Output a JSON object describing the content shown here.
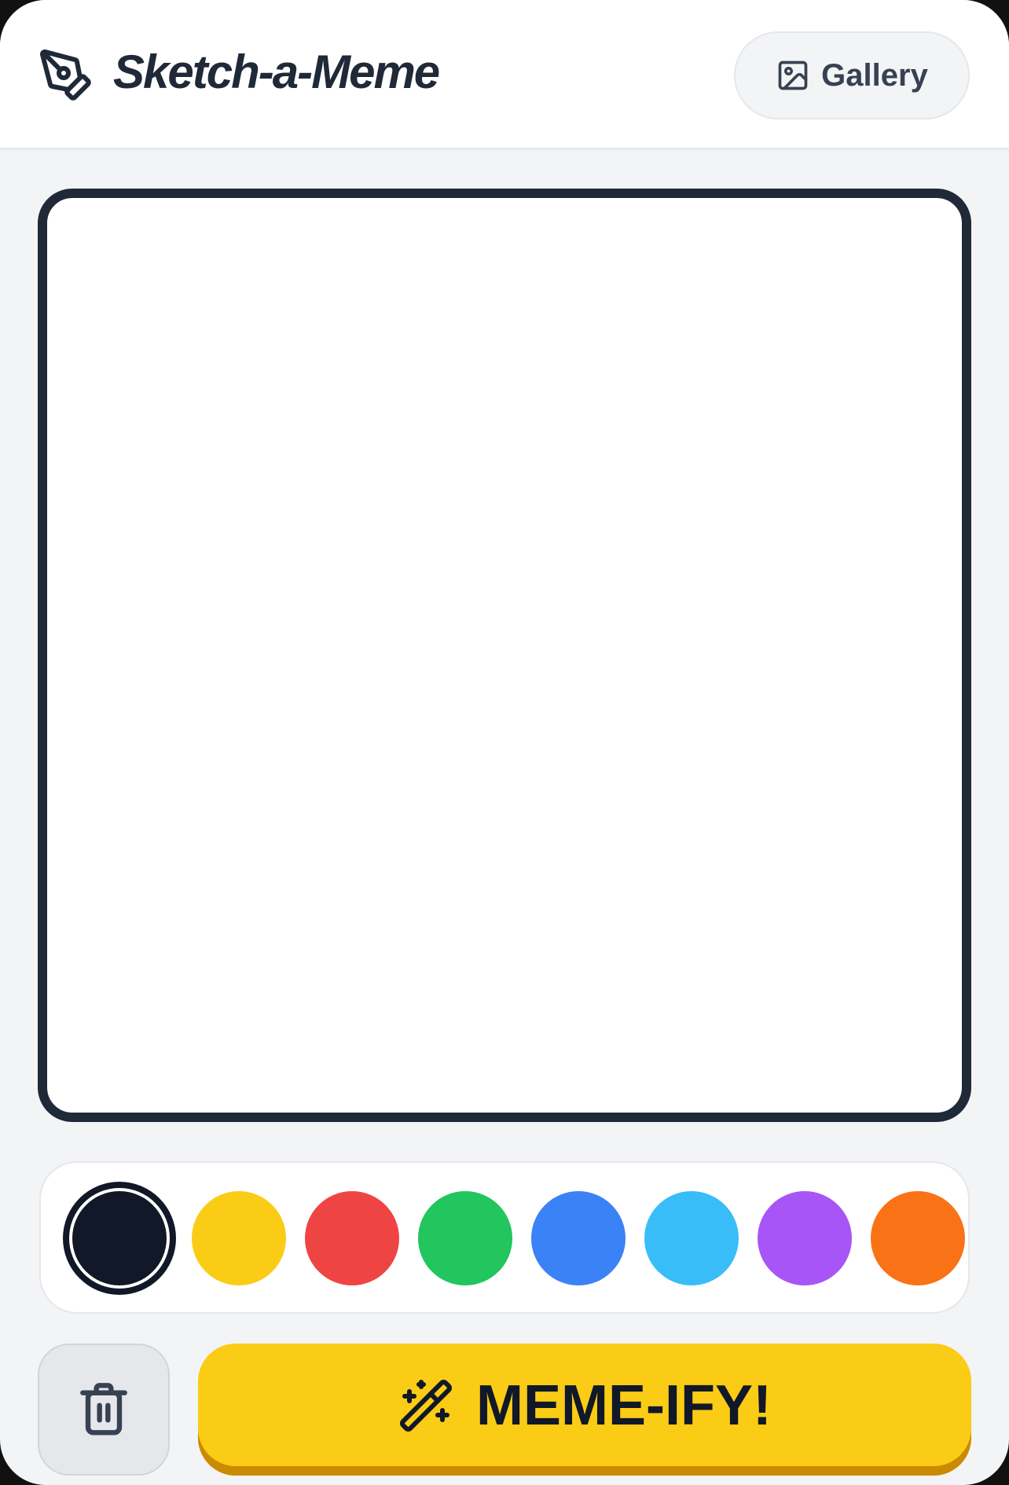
{
  "header": {
    "title": "Sketch-a-Meme",
    "brand_icon": "pen-tool-icon",
    "gallery_label": "Gallery",
    "gallery_icon": "image-icon"
  },
  "canvas": {
    "background": "#ffffff",
    "border_color": "#1f2937"
  },
  "palette": {
    "selected_index": 0,
    "colors": [
      "#111827",
      "#facc15",
      "#ef4444",
      "#22c55e",
      "#3b82f6",
      "#38bdf8",
      "#a855f7",
      "#f97316"
    ]
  },
  "actions": {
    "clear_icon": "trash-icon",
    "memeify_label": "MEME-IFY!",
    "memeify_icon": "magic-wand-icon",
    "memeify_color": "#facc15"
  }
}
